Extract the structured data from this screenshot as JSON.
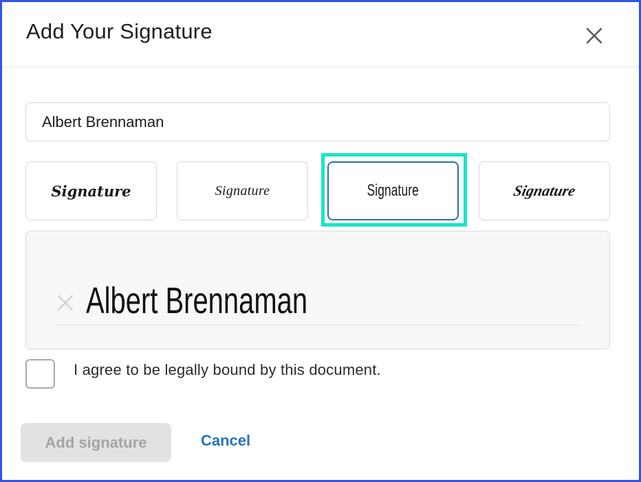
{
  "dialog": {
    "title": "Add Your Signature",
    "close_icon": "close-icon"
  },
  "name_field": {
    "value": "Albert Brennaman"
  },
  "signature_styles": [
    {
      "label": "Signature",
      "selected": false
    },
    {
      "label": "Signature",
      "selected": false
    },
    {
      "label": "Signature",
      "selected": true
    },
    {
      "label": "Signature",
      "selected": false
    }
  ],
  "preview": {
    "signature_text": "Albert Brennaman",
    "clear_icon": "close-icon"
  },
  "agreement": {
    "checked": false,
    "label": "I agree to be legally bound by this document."
  },
  "actions": {
    "add_label": "Add signature",
    "cancel_label": "Cancel"
  },
  "colors": {
    "frame_border": "#2f55e6",
    "highlight": "#17e5c9",
    "selected_border": "#2a6fa8",
    "link": "#2375b9",
    "disabled_bg": "#e2e2e2"
  }
}
